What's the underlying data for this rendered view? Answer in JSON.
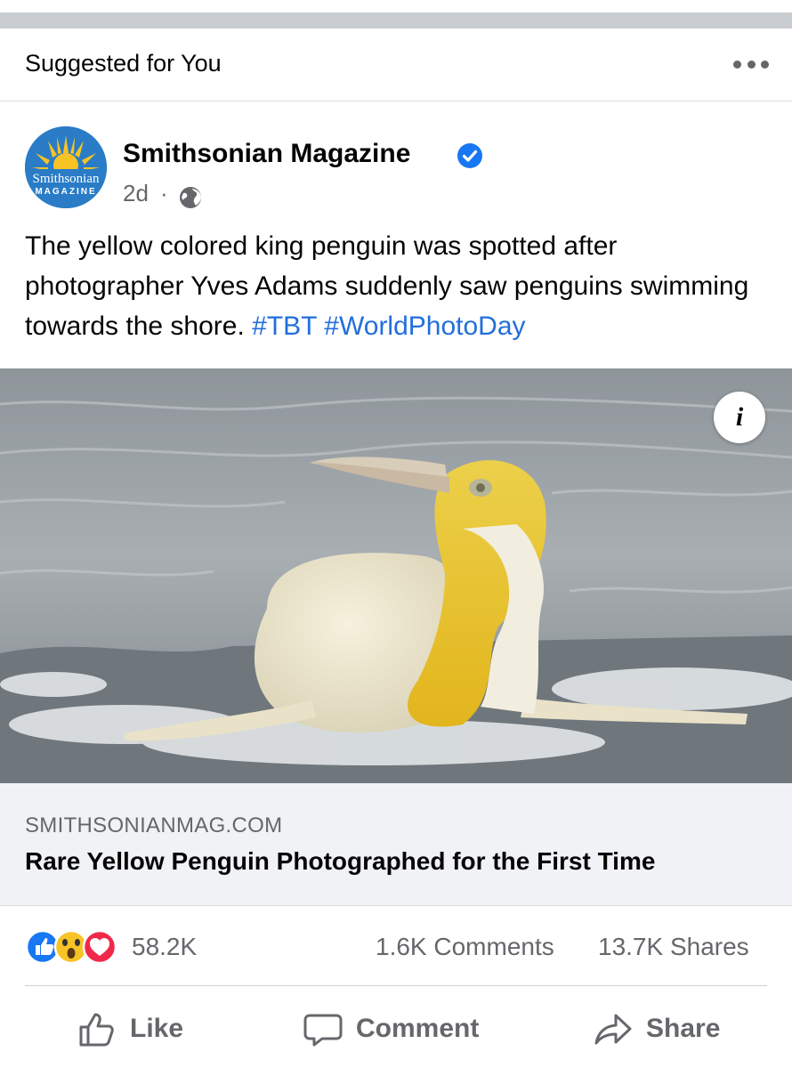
{
  "header": {
    "title": "Suggested for You",
    "more_icon": "more-dots-icon"
  },
  "post": {
    "page_name": "Smithsonian Magazine",
    "avatar_line1": "Smithsonian",
    "avatar_line2": "MAGAZINE",
    "verified_icon": "verified-badge-icon",
    "time": "2d",
    "separator": "·",
    "audience_icon": "globe-icon",
    "text": "The yellow colored king penguin was spotted after photographer Yves Adams suddenly saw penguins swimming towards the shore.",
    "hashtags": [
      "#TBT",
      "#WorldPhotoDay"
    ]
  },
  "photo": {
    "info_label": "i"
  },
  "link": {
    "domain": "SMITHSONIANMAG.COM",
    "title": "Rare Yellow Penguin Photographed for the First Time"
  },
  "stats": {
    "reaction_icons": [
      "like-icon",
      "wow-icon",
      "love-icon"
    ],
    "reactions": "58.2K",
    "comments": "1.6K Comments",
    "shares": "13.7K Shares"
  },
  "actions": {
    "like": "Like",
    "comment": "Comment",
    "share": "Share"
  },
  "colors": {
    "hashtag": "#216fdb",
    "verified": "#1877f2",
    "link_bg": "#f0f2f5",
    "secondary_text": "#65676b"
  }
}
